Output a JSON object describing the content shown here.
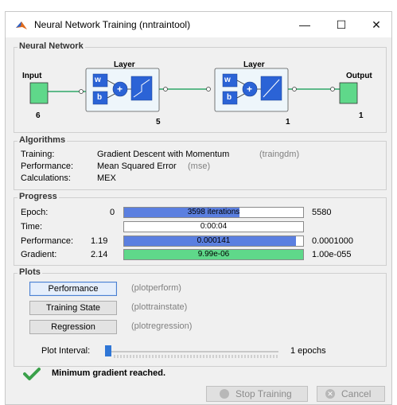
{
  "window": {
    "title": "Neural Network Training (nntraintool)",
    "minimize_glyph": "—",
    "maximize_glyph": "☐",
    "close_glyph": "✕"
  },
  "network": {
    "section_title": "Neural Network",
    "input_label": "Input",
    "input_size": "6",
    "layer1_title": "Layer",
    "layer1_size": "5",
    "layer2_title": "Layer",
    "layer2_size": "1",
    "output_label": "Output",
    "output_size": "1",
    "weight_label": "w",
    "bias_label": "b",
    "sum_glyph": "+"
  },
  "algorithms": {
    "section_title": "Algorithms",
    "rows": [
      {
        "label": "Training:",
        "value": "Gradient Descent with Momentum",
        "hint": "(traingdm)"
      },
      {
        "label": "Performance:",
        "value": "Mean Squared Error",
        "hint": "(mse)"
      },
      {
        "label": "Calculations:",
        "value": "MEX",
        "hint": ""
      }
    ]
  },
  "progress": {
    "section_title": "Progress",
    "rows": [
      {
        "label": "Epoch:",
        "start": "0",
        "value": "3598 iterations",
        "end": "5580",
        "fraction": 0.645,
        "color": "#5b7fe0"
      },
      {
        "label": "Time:",
        "start": "",
        "value": "0:00:04",
        "end": "",
        "fraction": 0,
        "color": "#5b7fe0"
      },
      {
        "label": "Performance:",
        "start": "1.19",
        "value": "0.000141",
        "end": "0.0001000",
        "fraction": 0.96,
        "color": "#5b7fe0"
      },
      {
        "label": "Gradient:",
        "start": "2.14",
        "value": "9.99e-06",
        "end": "1.00e-055",
        "fraction": 1.0,
        "color": "#5fd88a"
      }
    ]
  },
  "plots": {
    "section_title": "Plots",
    "buttons": [
      {
        "label": "Performance",
        "hint": "(plotperform)"
      },
      {
        "label": "Training State",
        "hint": "(plottrainstate)"
      },
      {
        "label": "Regression",
        "hint": "(plotregression)"
      }
    ],
    "interval_label": "Plot Interval:",
    "interval_value": "1 epochs"
  },
  "status": {
    "message": "Minimum gradient reached."
  },
  "actions": {
    "stop_label": "Stop Training",
    "cancel_label": "Cancel"
  }
}
